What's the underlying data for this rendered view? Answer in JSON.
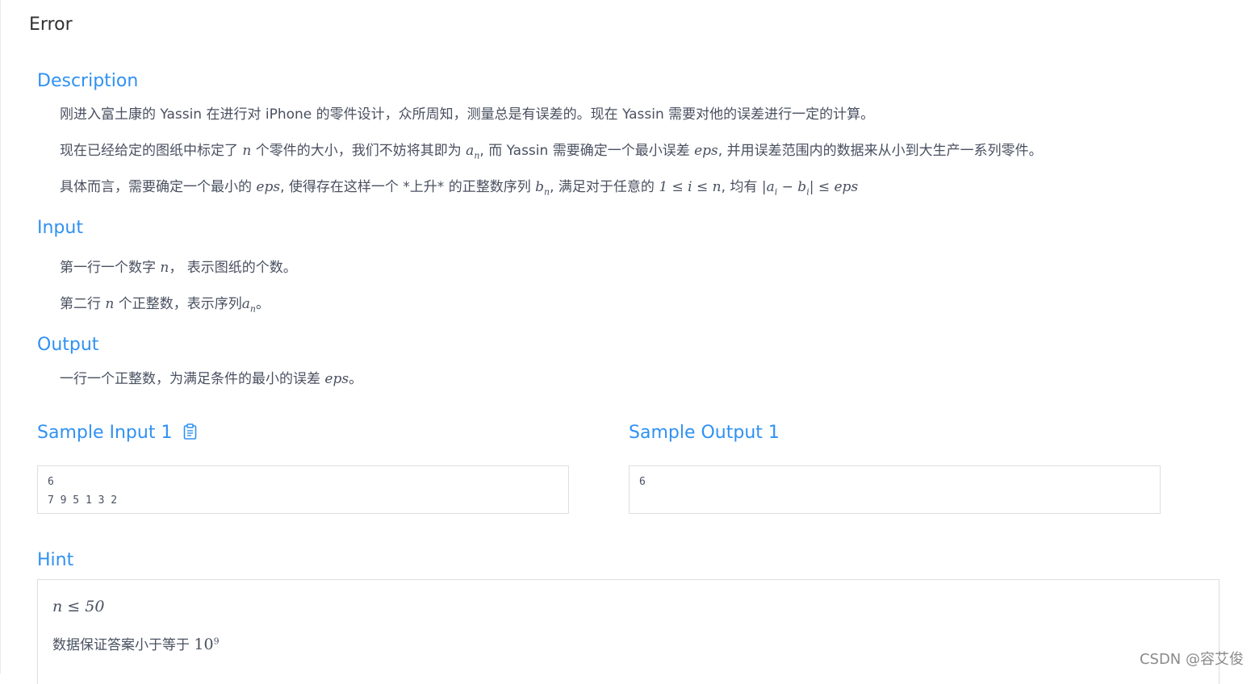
{
  "page": {
    "title": "Error"
  },
  "description": {
    "heading": "Description",
    "p1": "刚进入富土康的 Yassin 在进行对 iPhone 的零件设计，众所周知，测量总是有误差的。现在 Yassin 需要对他的误差进行一定的计算。",
    "p2": {
      "t1": "现在已经给定的图纸中标定了 ",
      "m_n": "n",
      "t2": " 个零件的大小，我们不妨将其即为 ",
      "m_a": "a",
      "m_sub": "n",
      "t3": ", 而 Yassin 需要确定一个最小误差 ",
      "m_eps": "eps",
      "t4": ", 并用误差范围内的数据来从小到大生产一系列零件。"
    },
    "p3": {
      "t1": "具体而言，需要确定一个最小的 ",
      "m_eps": "eps",
      "t2": ", 使得存在这样一个 *上升* 的正整数序列 ",
      "m_b": "b",
      "m_sub": "n",
      "t3": ", 满足对于任意的 ",
      "m_range": "1 ≤ i ≤ n",
      "t4": ", 均有 ",
      "m_cond": "|a",
      "m_cond_sub1": "i",
      "m_cond_mid": " − b",
      "m_cond_sub2": "i",
      "m_cond_end": "| ≤ eps"
    }
  },
  "input": {
    "heading": "Input",
    "p1": {
      "t1": "第一行一个数字 ",
      "m_n": "n",
      "t2": "， 表示图纸的个数。"
    },
    "p2": {
      "t1": "第二行 ",
      "m_n": "n",
      "t2": " 个正整数，表示序列",
      "m_a": "a",
      "m_sub": "n",
      "t3": "。"
    }
  },
  "output": {
    "heading": "Output",
    "p1": {
      "t1": "一行一个正整数，为满足条件的最小的误差 ",
      "m_eps": "eps",
      "t2": "。"
    }
  },
  "samples": {
    "input_heading": "Sample Input 1",
    "input_text": "6\n7 9 5 1 3 2",
    "output_heading": "Sample Output 1",
    "output_text": "6",
    "copy_icon": "clipboard-icon"
  },
  "hint": {
    "heading": "Hint",
    "line1": "n ≤ 50",
    "line2": {
      "t1": "数据保证答案小于等于 ",
      "m_base": "10",
      "m_exp": "9"
    }
  },
  "watermark": "CSDN @容艾俊",
  "colors": {
    "accent": "#3091f2",
    "text": "#495060",
    "border": "#dcdee2"
  }
}
